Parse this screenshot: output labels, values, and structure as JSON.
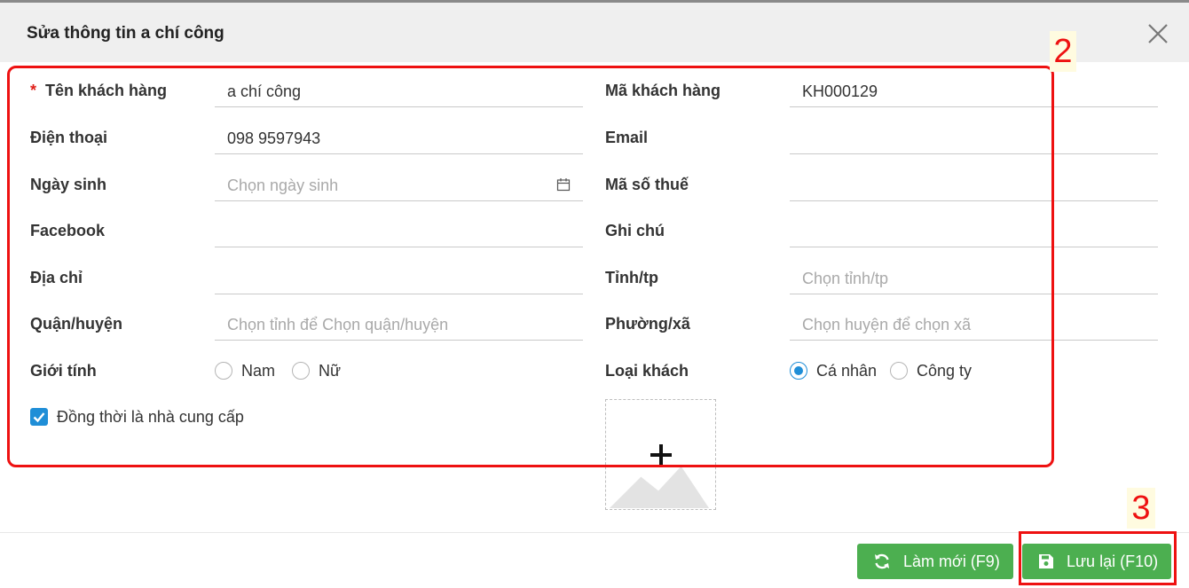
{
  "dialog": {
    "title": "Sửa thông tin a chí công"
  },
  "annotations": {
    "marker_form": "2",
    "marker_save": "3",
    "color": "#ee1111"
  },
  "form": {
    "required_mark": "*",
    "customer_name": {
      "label": "Tên khách hàng",
      "value": "a chí công"
    },
    "customer_code": {
      "label": "Mã khách hàng",
      "value": "KH000129"
    },
    "phone": {
      "label": "Điện thoại",
      "value": "098 9597943"
    },
    "email": {
      "label": "Email",
      "value": ""
    },
    "birthday": {
      "label": "Ngày sinh",
      "placeholder": "Chọn ngày sinh"
    },
    "tax_code": {
      "label": "Mã số thuế",
      "value": ""
    },
    "facebook": {
      "label": "Facebook",
      "value": ""
    },
    "note": {
      "label": "Ghi chú",
      "value": ""
    },
    "address": {
      "label": "Địa chỉ",
      "value": ""
    },
    "province": {
      "label": "Tỉnh/tp",
      "placeholder": "Chọn tỉnh/tp"
    },
    "district": {
      "label": "Quận/huyện",
      "placeholder": "Chọn tỉnh để Chọn quận/huyện"
    },
    "ward": {
      "label": "Phường/xã",
      "placeholder": "Chọn huyện để chọn xã"
    },
    "gender": {
      "label": "Giới tính",
      "options": [
        "Nam",
        "Nữ"
      ],
      "selected": ""
    },
    "customer_type": {
      "label": "Loại khách",
      "options": [
        "Cá nhân",
        "Công ty"
      ],
      "selected": "Cá nhân"
    },
    "is_supplier": {
      "label": "Đồng thời là nhà cung cấp",
      "checked": true
    }
  },
  "footer": {
    "refresh_label": "Làm mới (F9)",
    "save_label": "Lưu lại (F10)",
    "button_color": "#4caf50"
  },
  "icons": [
    "close-icon",
    "calendar-icon",
    "check-icon",
    "plus-icon",
    "image-placeholder-icon",
    "refresh-icon",
    "save-icon"
  ]
}
